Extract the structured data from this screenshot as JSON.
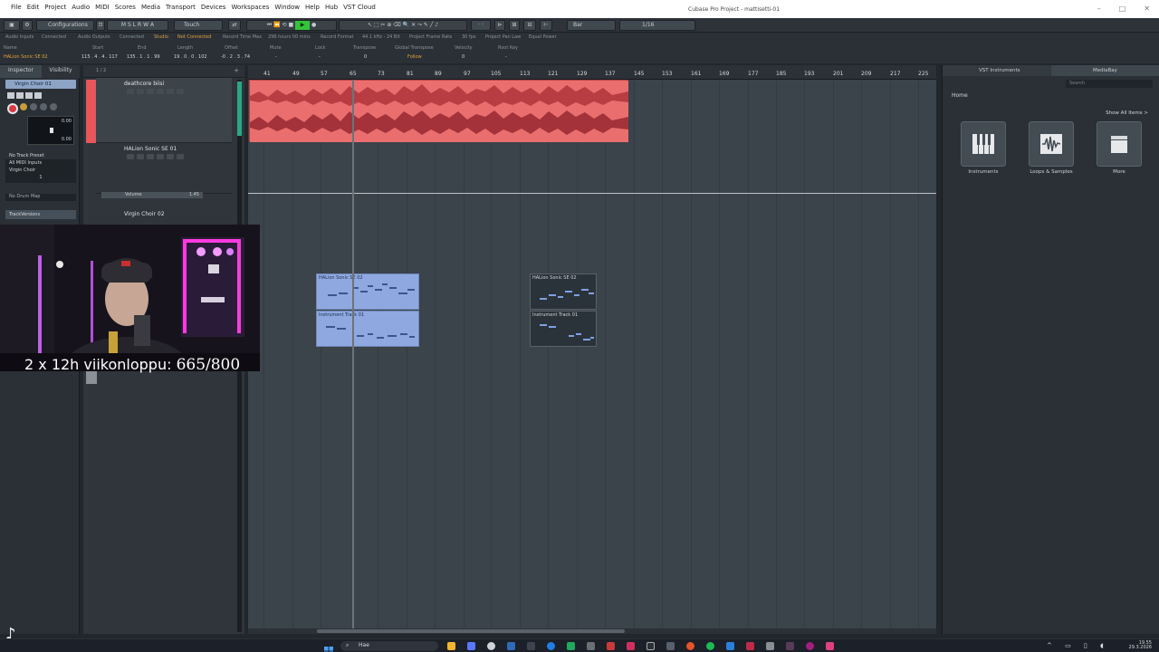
{
  "menu": [
    "File",
    "Edit",
    "Project",
    "Audio",
    "MIDI",
    "Scores",
    "Media",
    "Transport",
    "Devices",
    "Workspaces",
    "Window",
    "Help",
    "Hub",
    "VST Cloud"
  ],
  "app_title": "Cubase Pro Project - mattisetti-01",
  "toolbar": {
    "configurations": "Configurations",
    "touch_mode": "Touch",
    "snap_mode": "Bar",
    "quantize": "1/16",
    "msr": [
      "M",
      "S",
      "L",
      "R",
      "W",
      "A"
    ]
  },
  "status_line": {
    "audio_inputs": "Audio Inputs",
    "audio_inputs_val": "Connected",
    "audio_outputs": "Audio Outputs",
    "audio_outputs_val": "Connected",
    "studio": "Studio",
    "studio_val": "Not Connected",
    "record_time_max": "Record Time Max",
    "record_time_val": "296 hours 00 mins",
    "record_format": "Record Format",
    "record_format_val": "44.1 kHz - 24 Bit",
    "frame_rate": "Project Frame Rate",
    "frame_rate_val": "30 fps",
    "pan_law": "Project Pan Law",
    "pan_law_val": "Equal Power"
  },
  "info_line": {
    "labels": [
      "Name",
      "Start",
      "End",
      "Length",
      "Offset",
      "Mute",
      "Lock",
      "Transpose",
      "Global Transpose",
      "Velocity",
      "Root Key"
    ],
    "name": "HALion Sonic SE 02",
    "start": "115 . 4 . 4 . 117",
    "end": "135 . 1 . 1 . 99",
    "length": "19 . 0 . 0 . 102",
    "offset": "-0 . 2 . 3 . 74",
    "mute": "-",
    "lock": "-",
    "transpose": "0",
    "global_transpose": "Follow",
    "velocity": "0",
    "root_key": "-"
  },
  "inspector": {
    "tabs": [
      "Inspector",
      "Visibility"
    ],
    "track_name": "Virgin Choir 01",
    "fader_top": "0.00",
    "fader_bottom": "0.00",
    "routing": [
      "No Track Preset",
      "All MIDI Inputs",
      "Virgin Choir"
    ],
    "channel": "1",
    "drum_map": "No Drum Map",
    "track_versions": "TrackVersions"
  },
  "tracklist": {
    "counter": "1 / 2",
    "tracks": [
      {
        "name": "deathcore biisi"
      },
      {
        "name": "HALion Sonic SE 01"
      },
      {
        "name": "Virgin Choir 02"
      }
    ],
    "volume_label": "Volume",
    "volume_value": "1.45"
  },
  "ruler": [
    "41",
    "49",
    "57",
    "65",
    "73",
    "81",
    "89",
    "97",
    "105",
    "113",
    "121",
    "129",
    "137",
    "145",
    "153",
    "161",
    "169",
    "177",
    "185",
    "193",
    "201",
    "209",
    "217",
    "225"
  ],
  "events": {
    "midi1_top": "HALion Sonic SE 02",
    "midi1_bottom": "Instrument Track 01",
    "midi2_top": "HALion Sonic SE 02",
    "midi2_bottom": "Instrument Track 01"
  },
  "right_zone": {
    "tabs": [
      "VST Instruments",
      "MediaBay"
    ],
    "search_placeholder": "Search",
    "home": "Home",
    "show_all": "Show All Items >",
    "cards": [
      "Instruments",
      "Loops & Samples",
      "More"
    ]
  },
  "overlay": {
    "text": "2 x 12h viikonloppu:",
    "counter": "665/800"
  },
  "taskbar": {
    "search": "Hae",
    "time": "19.55",
    "date": "29.3.2026"
  }
}
